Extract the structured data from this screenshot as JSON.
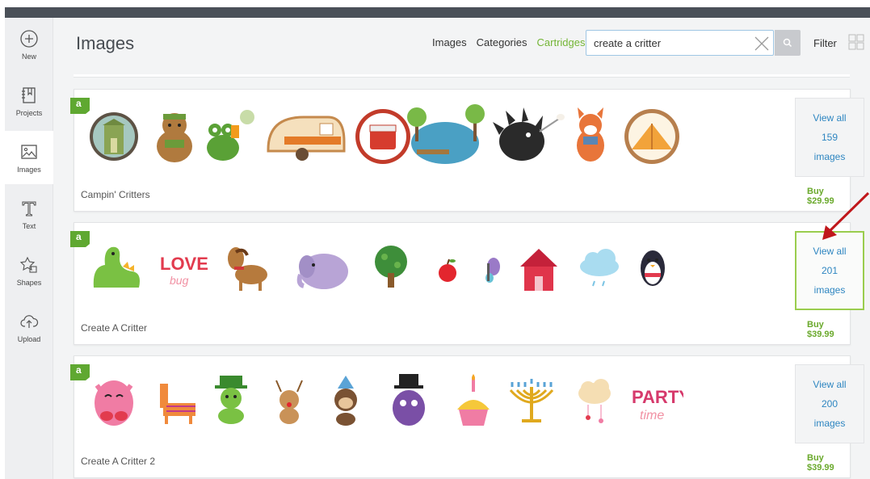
{
  "sidebar": {
    "items": [
      {
        "label": "New",
        "icon": "plus-circle-icon"
      },
      {
        "label": "Projects",
        "icon": "notebook-icon"
      },
      {
        "label": "Images",
        "icon": "image-icon"
      },
      {
        "label": "Text",
        "icon": "text-t-icon"
      },
      {
        "label": "Shapes",
        "icon": "shapes-icon"
      },
      {
        "label": "Upload",
        "icon": "cloud-upload-icon"
      }
    ],
    "active": "Images"
  },
  "header": {
    "title": "Images",
    "nav": [
      "Images",
      "Categories",
      "Cartridges"
    ],
    "active_nav": "Cartridges",
    "search_value": "create a critter",
    "filter_label": "Filter"
  },
  "cartridges": [
    {
      "name": "Campin' Critters",
      "view_line1": "View all",
      "count": "159",
      "view_line3": "images",
      "price": "Buy $29.99",
      "badge": "a"
    },
    {
      "name": "Create A Critter",
      "view_line1": "View all",
      "count": "201",
      "view_line3": "images",
      "price": "Buy $39.99",
      "badge": "a"
    },
    {
      "name": "Create A Critter 2",
      "view_line1": "View all",
      "count": "200",
      "view_line3": "images",
      "price": "Buy $39.99",
      "badge": "a"
    }
  ],
  "image_art": {
    "love_text": "LOVE",
    "bug_text": "bug",
    "party_text": "PARTY",
    "time_text": "time"
  },
  "colors": {
    "accent_green": "#74b536",
    "link_blue": "#2e86c1",
    "badge_green": "#5fa831",
    "arrow_red": "#c0171b"
  }
}
